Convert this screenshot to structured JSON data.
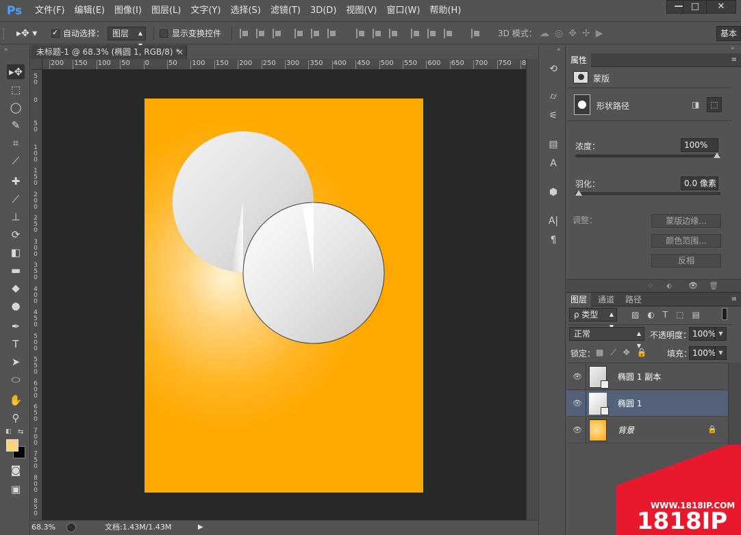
{
  "app": {
    "logo": "Ps",
    "menu": [
      "文件(F)",
      "编辑(E)",
      "图像(I)",
      "图层(L)",
      "文字(Y)",
      "选择(S)",
      "滤镜(T)",
      "3D(D)",
      "视图(V)",
      "窗口(W)",
      "帮助(H)"
    ],
    "window_buttons": {
      "minimize": "—",
      "maximize": "□",
      "close": "✕"
    }
  },
  "options": {
    "auto_select_label": "自动选择：",
    "auto_select_checked": true,
    "auto_select_target": "图层",
    "show_transform_label": "显示变换控件",
    "show_transform_checked": false,
    "mode_3d_label": "3D 模式：",
    "workspace_button": "基本"
  },
  "document": {
    "tab_title": "未标题-1 @ 68.3% (椭圆 1, RGB/8) *",
    "ruler_h": [
      "200",
      "150",
      "100",
      "50",
      "0",
      "50",
      "100",
      "150",
      "200",
      "250",
      "300",
      "350",
      "400",
      "450",
      "500",
      "550",
      "600",
      "650",
      "700",
      "750",
      "8"
    ],
    "ruler_v": [
      "5\n0",
      "0",
      "5\n0",
      "1\n0\n0",
      "1\n5\n0",
      "2\n0\n0",
      "2\n5\n0",
      "3\n0\n0",
      "3\n5\n0",
      "4\n0\n0",
      "4\n5\n0",
      "5\n0\n0",
      "5\n5\n0",
      "6\n0\n0",
      "6\n5\n0",
      "7\n0\n0",
      "7\n5\n0",
      "8\n0\n0",
      "8\n5\n0"
    ],
    "background_gradient": [
      "#fff4d6",
      "#ffa800"
    ],
    "shape_fill": [
      "#ffffff",
      "#c9c7c8"
    ]
  },
  "status": {
    "zoom": "68.3%",
    "doc_info": "文档:1.43M/1.43M"
  },
  "properties": {
    "tab": "属性",
    "mask_label": "蒙版",
    "shape_path_label": "形状路径",
    "density_label": "浓度：",
    "density_value": "100%",
    "density_level": 1.0,
    "feather_label": "羽化：",
    "feather_value": "0.0 像素",
    "feather_level": 0.0,
    "adjust_label": "调整：",
    "btn_mask_edge": "蒙版边缘...",
    "btn_color_range": "颜色范围...",
    "btn_invert": "反相"
  },
  "layers_panel": {
    "tabs": [
      "图层",
      "通道",
      "路径"
    ],
    "filter_label": "ρ 类型",
    "blend_mode": "正常",
    "opacity_label": "不透明度：",
    "opacity_value": "100%",
    "lock_label": "锁定：",
    "fill_label": "填充：",
    "fill_value": "100%",
    "layers": [
      {
        "name": "椭圆 1 副本",
        "selected": false
      },
      {
        "name": "椭圆 1",
        "selected": true
      },
      {
        "name": "背景",
        "selected": false,
        "locked": true
      }
    ]
  },
  "colors": {
    "foreground": "#ffd27f",
    "background": "#000000",
    "accent": "#4aa3ff"
  },
  "watermark": {
    "url": "WWW.1818IP.COM",
    "brand": "1818IP"
  }
}
